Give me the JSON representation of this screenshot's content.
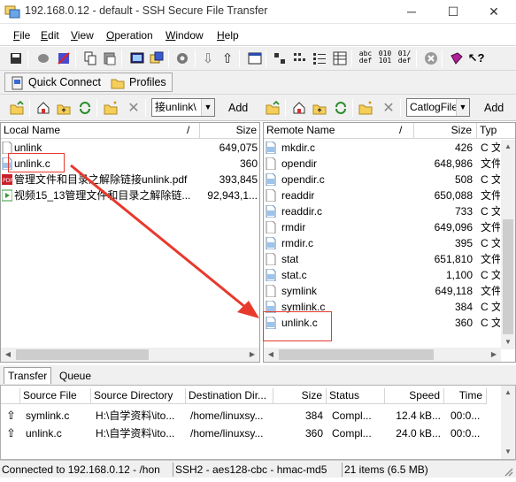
{
  "window": {
    "title": "192.168.0.12 - default - SSH Secure File Transfer",
    "minimize": "─",
    "maximize": "☐",
    "close": "✕"
  },
  "menu": [
    {
      "label": "File",
      "accel": "F"
    },
    {
      "label": "Edit",
      "accel": "E"
    },
    {
      "label": "View",
      "accel": "V"
    },
    {
      "label": "Operation",
      "accel": "O"
    },
    {
      "label": "Window",
      "accel": "W"
    },
    {
      "label": "Help",
      "accel": "H"
    }
  ],
  "toolbar2": {
    "quick_connect": "Quick Connect",
    "profiles": "Profiles"
  },
  "local_toolbar": {
    "path_value": "接unlink\\",
    "add": "Add"
  },
  "remote_toolbar": {
    "path_value": "CatlogFile",
    "add": "Add"
  },
  "local_pane": {
    "headers": {
      "name": "Local Name",
      "slash": "/",
      "size": "Size"
    },
    "rows": [
      {
        "name": "unlink",
        "size": "649,075",
        "icon": "file-icon"
      },
      {
        "name": "unlink.c",
        "size": "360",
        "icon": "c-file-icon"
      },
      {
        "name": "管理文件和目录之解除链接unlink.pdf",
        "size": "393,845",
        "icon": "pdf-icon"
      },
      {
        "name": "视频15_13管理文件和目录之解除链...",
        "size": "92,943,1...",
        "icon": "video-icon"
      }
    ]
  },
  "remote_pane": {
    "headers": {
      "name": "Remote Name",
      "slash": "/",
      "size": "Size",
      "type": "Typ"
    },
    "rows": [
      {
        "name": "mkdir.c",
        "size": "426",
        "type": "C 文",
        "icon": "c-file-icon"
      },
      {
        "name": "opendir",
        "size": "648,986",
        "type": "文件",
        "icon": "file-icon"
      },
      {
        "name": "opendir.c",
        "size": "508",
        "type": "C 文",
        "icon": "c-file-icon"
      },
      {
        "name": "readdir",
        "size": "650,088",
        "type": "文件",
        "icon": "file-icon"
      },
      {
        "name": "readdir.c",
        "size": "733",
        "type": "C 文",
        "icon": "c-file-icon"
      },
      {
        "name": "rmdir",
        "size": "649,096",
        "type": "文件",
        "icon": "file-icon"
      },
      {
        "name": "rmdir.c",
        "size": "395",
        "type": "C 文",
        "icon": "c-file-icon"
      },
      {
        "name": "stat",
        "size": "651,810",
        "type": "文件",
        "icon": "file-icon"
      },
      {
        "name": "stat.c",
        "size": "1,100",
        "type": "C 文",
        "icon": "c-file-icon"
      },
      {
        "name": "symlink",
        "size": "649,118",
        "type": "文件",
        "icon": "file-icon"
      },
      {
        "name": "symlink.c",
        "size": "384",
        "type": "C 文",
        "icon": "c-file-icon"
      },
      {
        "name": "unlink.c",
        "size": "360",
        "type": "C 文",
        "icon": "c-file-icon"
      }
    ]
  },
  "transfer_tabs": [
    "Transfer",
    "Queue"
  ],
  "transfer": {
    "headers": {
      "source_file": "Source File",
      "source_directory": "Source Directory",
      "destination_directory": "Destination Dir...",
      "size": "Size",
      "status": "Status",
      "speed": "Speed",
      "time": "Time"
    },
    "rows": [
      {
        "source_file": "symlink.c",
        "source_directory": "H:\\自学资料\\ito...",
        "destination_directory": "/home/linuxsy...",
        "size": "384",
        "status": "Compl...",
        "speed": "12.4 kB...",
        "time": "00:0..."
      },
      {
        "source_file": "unlink.c",
        "source_directory": "H:\\自学资料\\ito...",
        "destination_directory": "/home/linuxsy...",
        "size": "360",
        "status": "Compl...",
        "speed": "24.0 kB...",
        "time": "00:0..."
      }
    ]
  },
  "statusbar": {
    "connection": "Connected to 192.168.0.12 - /hon",
    "cipher": "SSH2 - aes128-cbc - hmac-md5",
    "items": "21 items (6.5 MB)"
  }
}
